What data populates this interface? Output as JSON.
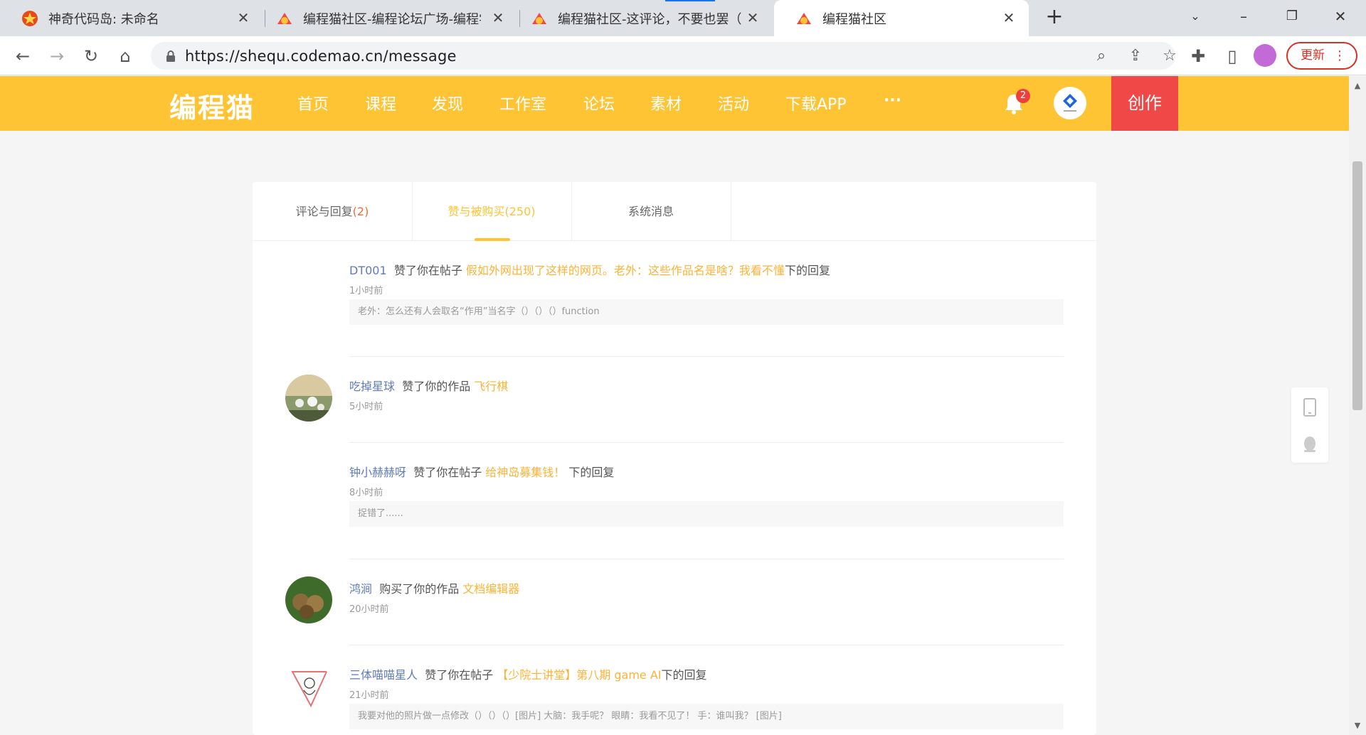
{
  "browser": {
    "tabs": [
      {
        "title": "神奇代码岛: 未命名",
        "active": false
      },
      {
        "title": "编程猫社区-编程论坛广场-编程学",
        "active": false
      },
      {
        "title": "编程猫社区-这评论，不要也罢（",
        "active": false
      },
      {
        "title": "编程猫社区",
        "active": true
      }
    ],
    "url": "https://shequ.codemao.cn/message",
    "update_label": "更新",
    "accent": "#1a73e8"
  },
  "site": {
    "logo": "编程猫",
    "nav": [
      "首页",
      "课程",
      "发现",
      "工作室",
      "论坛",
      "素材",
      "活动",
      "下载APP",
      "···"
    ],
    "notification_count": "2",
    "create_label": "创作",
    "header_color": "#fec433",
    "create_color": "#f04747"
  },
  "message_tabs": [
    {
      "label": "评论与回复",
      "count": "(2)",
      "active": false
    },
    {
      "label": "赞与被购买",
      "count": "(250)",
      "active": true
    },
    {
      "label": "系统消息",
      "count": "",
      "active": false
    }
  ],
  "messages": [
    {
      "user": "DT001",
      "action": "赞了你在帖子",
      "target": "假如外网出现了这样的网页。老外：这些作品名是啥？我看不懂",
      "suffix": "下的回复",
      "time": "1小时前",
      "quote": "老外：怎么还有人会取名“作用”当名字（）（）（）function",
      "avatar": "none"
    },
    {
      "user": "吃掉星球",
      "action": "赞了你的作品",
      "target": "飞行棋",
      "suffix": "",
      "time": "5小时前",
      "quote": "",
      "avatar": "flowers"
    },
    {
      "user": "钟小赫赫呀",
      "action": "赞了你在帖子",
      "target": "给神岛募集钱！",
      "suffix": "下的回复",
      "time": "8小时前",
      "quote": "捉错了......",
      "avatar": "none"
    },
    {
      "user": "鸿涧",
      "action": "购买了你的作品",
      "target": "文档编辑器",
      "suffix": "",
      "time": "20小时前",
      "quote": "",
      "avatar": "animals"
    },
    {
      "user": "三体喵喵星人",
      "action": "赞了你在帖子",
      "target": "【少院士讲堂】第八期 game AI",
      "suffix": "下的回复",
      "time": "21小时前",
      "quote": "我要对他的照片做一点修改（）（）（）[图片] 大脑：我手呢？ 眼睛：我看不见了！ 手：谁叫我？ [图片]",
      "avatar": "sketch"
    }
  ],
  "colors": {
    "username": "#5f7bb8",
    "link": "#fdb336",
    "count": "#f06d3c"
  }
}
